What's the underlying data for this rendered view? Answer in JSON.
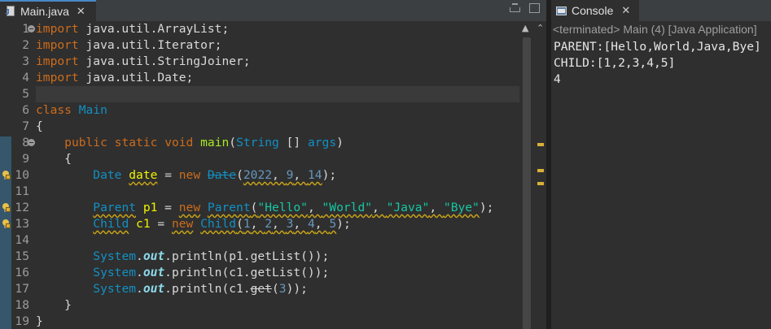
{
  "editor": {
    "tab_title": "Main.java",
    "lines": [
      {
        "num": "1",
        "tokens": [
          {
            "t": "import",
            "c": "kw"
          },
          {
            "t": " java.util.ArrayList;"
          }
        ]
      },
      {
        "num": "2",
        "tokens": [
          {
            "t": "import",
            "c": "kw"
          },
          {
            "t": " java.util.Iterator;"
          }
        ]
      },
      {
        "num": "3",
        "tokens": [
          {
            "t": "import",
            "c": "kw"
          },
          {
            "t": " java.util.StringJoiner;"
          }
        ]
      },
      {
        "num": "4",
        "tokens": [
          {
            "t": "import",
            "c": "kw"
          },
          {
            "t": " java.util.Date;"
          }
        ]
      },
      {
        "num": "5",
        "tokens": []
      },
      {
        "num": "6",
        "tokens": [
          {
            "t": "class",
            "c": "kw"
          },
          {
            "t": " "
          },
          {
            "t": "Main",
            "c": "cls"
          }
        ]
      },
      {
        "num": "7",
        "tokens": [
          {
            "t": "{"
          }
        ]
      },
      {
        "num": "8",
        "tokens": [
          {
            "t": "    "
          },
          {
            "t": "public",
            "c": "kw"
          },
          {
            "t": " "
          },
          {
            "t": "static",
            "c": "kw"
          },
          {
            "t": " "
          },
          {
            "t": "void",
            "c": "kw"
          },
          {
            "t": " "
          },
          {
            "t": "main",
            "c": "mth"
          },
          {
            "t": "("
          },
          {
            "t": "String",
            "c": "cls"
          },
          {
            "t": " [] "
          },
          {
            "t": "args",
            "c": "cls"
          },
          {
            "t": ")"
          }
        ]
      },
      {
        "num": "9",
        "tokens": [
          {
            "t": "    {"
          }
        ]
      },
      {
        "num": "10",
        "tokens": [
          {
            "t": "        "
          },
          {
            "t": "Date",
            "c": "cls"
          },
          {
            "t": " "
          },
          {
            "t": "date",
            "c": "var warn"
          },
          {
            "t": " = "
          },
          {
            "t": "new",
            "c": "kw"
          },
          {
            "t": " "
          },
          {
            "t": "Date",
            "c": "cls strike"
          },
          {
            "t": "("
          },
          {
            "t": "2022",
            "c": "num warn"
          },
          {
            "t": ", ",
            "c": "warn"
          },
          {
            "t": "9",
            "c": "num warn"
          },
          {
            "t": ", ",
            "c": "warn"
          },
          {
            "t": "14",
            "c": "num warn"
          },
          {
            "t": ");"
          }
        ]
      },
      {
        "num": "11",
        "tokens": []
      },
      {
        "num": "12",
        "tokens": [
          {
            "t": "        "
          },
          {
            "t": "Parent",
            "c": "cls warn"
          },
          {
            "t": " "
          },
          {
            "t": "p1",
            "c": "var"
          },
          {
            "t": " = "
          },
          {
            "t": "new",
            "c": "kw warn"
          },
          {
            "t": " "
          },
          {
            "t": "Parent",
            "c": "cls warn"
          },
          {
            "t": "(",
            "c": "warn"
          },
          {
            "t": "\"Hello\"",
            "c": "str warn"
          },
          {
            "t": ", ",
            "c": "warn"
          },
          {
            "t": "\"World\"",
            "c": "str warn"
          },
          {
            "t": ", ",
            "c": "warn"
          },
          {
            "t": "\"Java\"",
            "c": "str warn"
          },
          {
            "t": ", ",
            "c": "warn"
          },
          {
            "t": "\"Bye\"",
            "c": "str warn"
          },
          {
            "t": ");"
          }
        ]
      },
      {
        "num": "13",
        "tokens": [
          {
            "t": "        "
          },
          {
            "t": "Child",
            "c": "cls warn"
          },
          {
            "t": " "
          },
          {
            "t": "c1",
            "c": "var"
          },
          {
            "t": " = "
          },
          {
            "t": "new",
            "c": "kw warn"
          },
          {
            "t": " "
          },
          {
            "t": "Child",
            "c": "cls warn"
          },
          {
            "t": "(",
            "c": "warn"
          },
          {
            "t": "1",
            "c": "num warn"
          },
          {
            "t": ", ",
            "c": "warn"
          },
          {
            "t": "2",
            "c": "num warn"
          },
          {
            "t": ", ",
            "c": "warn"
          },
          {
            "t": "3",
            "c": "num warn"
          },
          {
            "t": ", ",
            "c": "warn"
          },
          {
            "t": "4",
            "c": "num warn"
          },
          {
            "t": ", ",
            "c": "warn"
          },
          {
            "t": "5",
            "c": "num warn"
          },
          {
            "t": ");"
          }
        ]
      },
      {
        "num": "14",
        "tokens": []
      },
      {
        "num": "15",
        "tokens": [
          {
            "t": "        "
          },
          {
            "t": "System",
            "c": "cls"
          },
          {
            "t": "."
          },
          {
            "t": "out",
            "c": "fld"
          },
          {
            "t": ".println(p1.getList());"
          }
        ]
      },
      {
        "num": "16",
        "tokens": [
          {
            "t": "        "
          },
          {
            "t": "System",
            "c": "cls"
          },
          {
            "t": "."
          },
          {
            "t": "out",
            "c": "fld"
          },
          {
            "t": ".println(c1.getList());"
          }
        ]
      },
      {
        "num": "17",
        "tokens": [
          {
            "t": "        "
          },
          {
            "t": "System",
            "c": "cls"
          },
          {
            "t": "."
          },
          {
            "t": "out",
            "c": "fld"
          },
          {
            "t": ".println(c1."
          },
          {
            "t": "get",
            "c": "strike"
          },
          {
            "t": "("
          },
          {
            "t": "3",
            "c": "num"
          },
          {
            "t": "));"
          }
        ]
      },
      {
        "num": "18",
        "tokens": [
          {
            "t": "    }"
          }
        ]
      },
      {
        "num": "19",
        "tokens": [
          {
            "t": "}"
          }
        ]
      }
    ],
    "fold_lines": [
      "1",
      "8"
    ],
    "warning_lines": [
      "10",
      "12",
      "13"
    ]
  },
  "console": {
    "tab_title": "Console",
    "status": "<terminated> Main (4) [Java Application]",
    "output": [
      "PARENT:[Hello,World,Java,Bye]",
      "CHILD:[1,2,3,4,5]",
      "4"
    ]
  },
  "icons": {
    "close": "close-icon",
    "java_file": "java-file-icon",
    "console": "console-icon",
    "lightbulb": "warning-lightbulb-icon"
  }
}
